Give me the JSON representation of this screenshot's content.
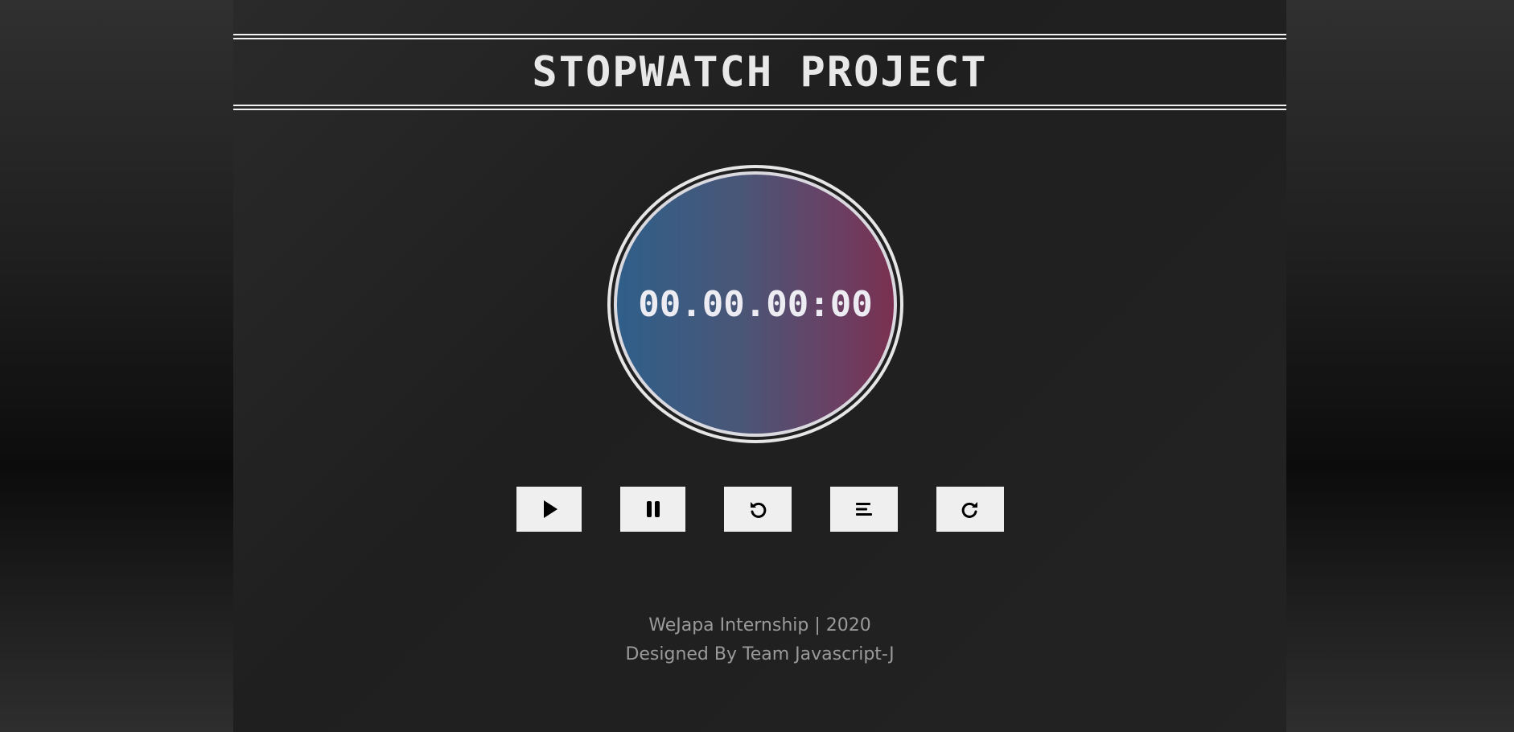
{
  "header": {
    "title": "STOPWATCH PROJECT"
  },
  "stopwatch": {
    "display": "00.00.00:00"
  },
  "controls": {
    "buttons": [
      {
        "name": "start",
        "icon": "play-icon"
      },
      {
        "name": "pause",
        "icon": "pause-icon"
      },
      {
        "name": "reset",
        "icon": "undo-icon"
      },
      {
        "name": "lap",
        "icon": "list-icon"
      },
      {
        "name": "resume",
        "icon": "redo-icon"
      }
    ]
  },
  "footer": {
    "line1": "WeJapa Internship | 2020",
    "line2": "Designed By Team Javascript-J"
  },
  "colors": {
    "background": "#1f1f1f",
    "title": "#e8e8e8",
    "dial_left": "#2f5f8a",
    "dial_right": "#7a3050",
    "button": "#efefef",
    "footer_text": "#9a9a9a"
  }
}
